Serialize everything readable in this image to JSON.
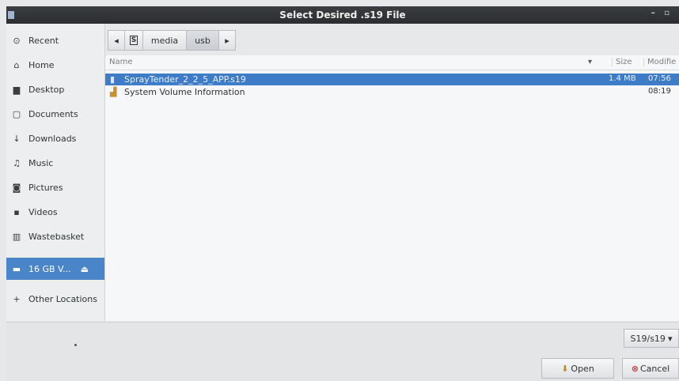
{
  "window": {
    "title": "Select Desired .s19 File",
    "controls": "– ▫"
  },
  "sidebar": {
    "items": [
      {
        "label": "Recent",
        "icon": "clock-icon",
        "glyph": "⊙"
      },
      {
        "label": "Home",
        "icon": "home-icon",
        "glyph": "⌂"
      },
      {
        "label": "Desktop",
        "icon": "folder-icon",
        "glyph": "▆"
      },
      {
        "label": "Documents",
        "icon": "document-icon",
        "glyph": "▢"
      },
      {
        "label": "Downloads",
        "icon": "download-icon",
        "glyph": "↓"
      },
      {
        "label": "Music",
        "icon": "music-icon",
        "glyph": "♫"
      },
      {
        "label": "Pictures",
        "icon": "camera-icon",
        "glyph": "◙"
      },
      {
        "label": "Videos",
        "icon": "video-icon",
        "glyph": "▪"
      },
      {
        "label": "Wastebasket",
        "icon": "trash-icon",
        "glyph": "▥"
      },
      {
        "label": "16 GB V...",
        "icon": "drive-icon",
        "glyph": "▬",
        "eject": "⏏"
      },
      {
        "label": "Other Locations",
        "icon": "plus-icon",
        "glyph": "+"
      }
    ]
  },
  "pathbar": {
    "back": "◂",
    "root_icon": "S",
    "crumbs": [
      "media",
      "usb"
    ],
    "forward": "▸"
  },
  "columns": {
    "name": "Name",
    "sort": "▾",
    "size": "Size",
    "modified": "Modifie"
  },
  "files": [
    {
      "name": "SprayTender_2_2_5_APP.s19",
      "size": "1.4 MB",
      "modified": "07:56",
      "selected": true,
      "icon": "file-icon",
      "glyph": "▮"
    },
    {
      "name": "System Volume Information",
      "size": "",
      "modified": "08:19",
      "selected": false,
      "icon": "folder-icon",
      "glyph": "▟"
    }
  ],
  "filter": {
    "value": "S19/s19",
    "arrow": "▾"
  },
  "actions": {
    "open": "Open",
    "open_glyph": "⬇",
    "cancel": "Cancel",
    "cancel_glyph": "⊗"
  },
  "colors": {
    "accent": "#4a84c9",
    "titlebar": "#2b2d30",
    "cancel_icon": "#d23b3b",
    "open_icon": "#b58b2a"
  }
}
